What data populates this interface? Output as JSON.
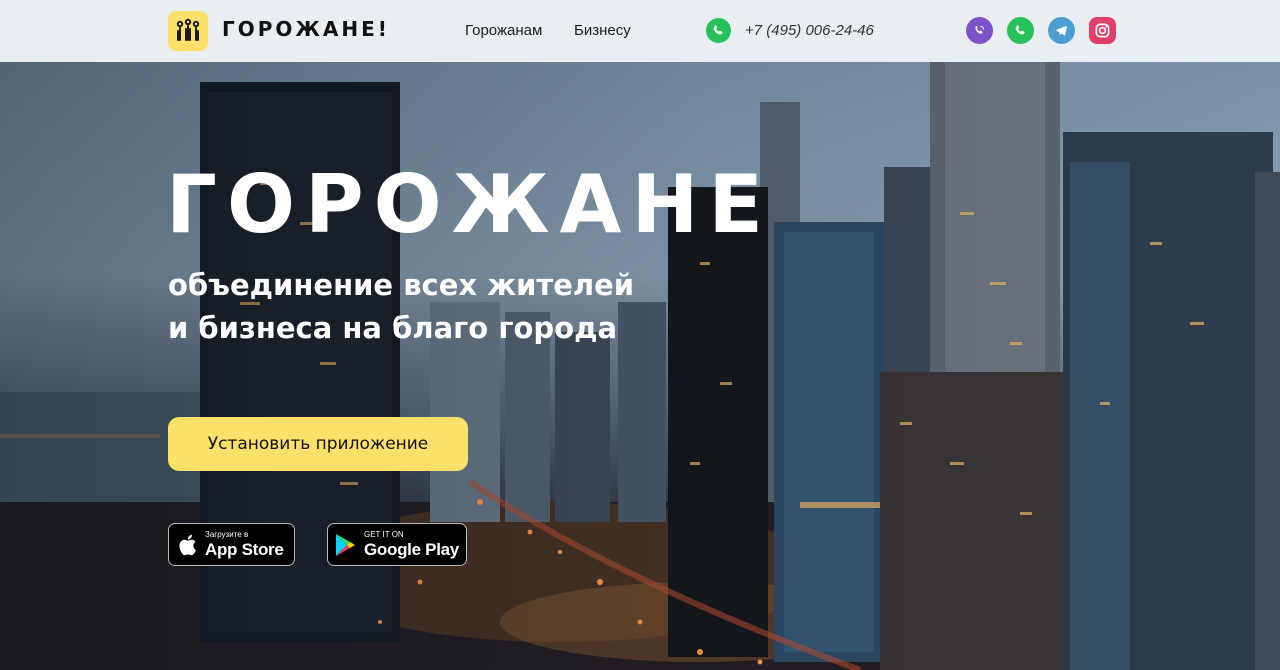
{
  "header": {
    "logo_text": "ГОРОЖАНЕ!",
    "nav": [
      {
        "label": "Горожанам"
      },
      {
        "label": "Бизнесу"
      }
    ],
    "phone": "+7 (495) 006-24-46",
    "socials": [
      "viber-icon",
      "whatsapp-icon",
      "telegram-icon",
      "instagram-icon"
    ]
  },
  "hero": {
    "title": "ГОРОЖАНЕ",
    "subtitle_line1": "объединение всех жителей",
    "subtitle_line2": "и бизнеса на благо города",
    "cta_label": "Установить приложение",
    "app_store": {
      "small": "Загрузите в",
      "big": "App Store"
    },
    "google_play": {
      "small": "GET IT ON",
      "big": "Google Play"
    }
  },
  "colors": {
    "header_bg": "#e9eef3",
    "accent_yellow": "#fbe06a",
    "whatsapp_green": "#27c15b",
    "viber_purple": "#7d52c9",
    "telegram_blue": "#4a9ed4",
    "instagram_pink": "#e03f6a"
  }
}
